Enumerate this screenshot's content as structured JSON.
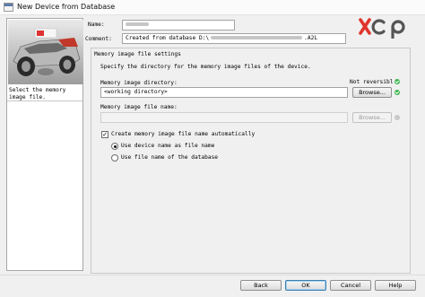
{
  "window": {
    "title": "New Device from Database"
  },
  "sidebar": {
    "description": "Select the memory image file."
  },
  "header": {
    "name_label": "Name:",
    "comment_label": "Comment:",
    "comment_prefix": "Created from database D:\\",
    "comment_suffix": ".A2L",
    "logo_text": "xcp"
  },
  "settings": {
    "group_title": "Memory image file settings",
    "instruction": "Specify the directory for the memory image files of the device.",
    "directory_label": "Memory image directory:",
    "not_reversible_label": "Not reversibl",
    "directory_value": "<working directory>",
    "browse_label": "Browse...",
    "file_name_label": "Memory image file name:",
    "file_name_value": "",
    "browse_disabled_label": "Browse...",
    "auto_create_label": "Create memory image file name automatically",
    "auto_create_checked": true,
    "radio_device_name_label": "Use device name as file name",
    "radio_database_name_label": "Use file name of the database",
    "selected_option": "device_name"
  },
  "buttons": {
    "back": "Back",
    "ok": "OK",
    "cancel": "Cancel",
    "help": "Help"
  },
  "colors": {
    "status_ok": "#37b24a",
    "logo_x": "#e0342b",
    "logo_cp": "#555555"
  },
  "icons": {
    "app": "window-icon",
    "status": "check-circle-icon",
    "checkbox": "checkmark-icon"
  }
}
